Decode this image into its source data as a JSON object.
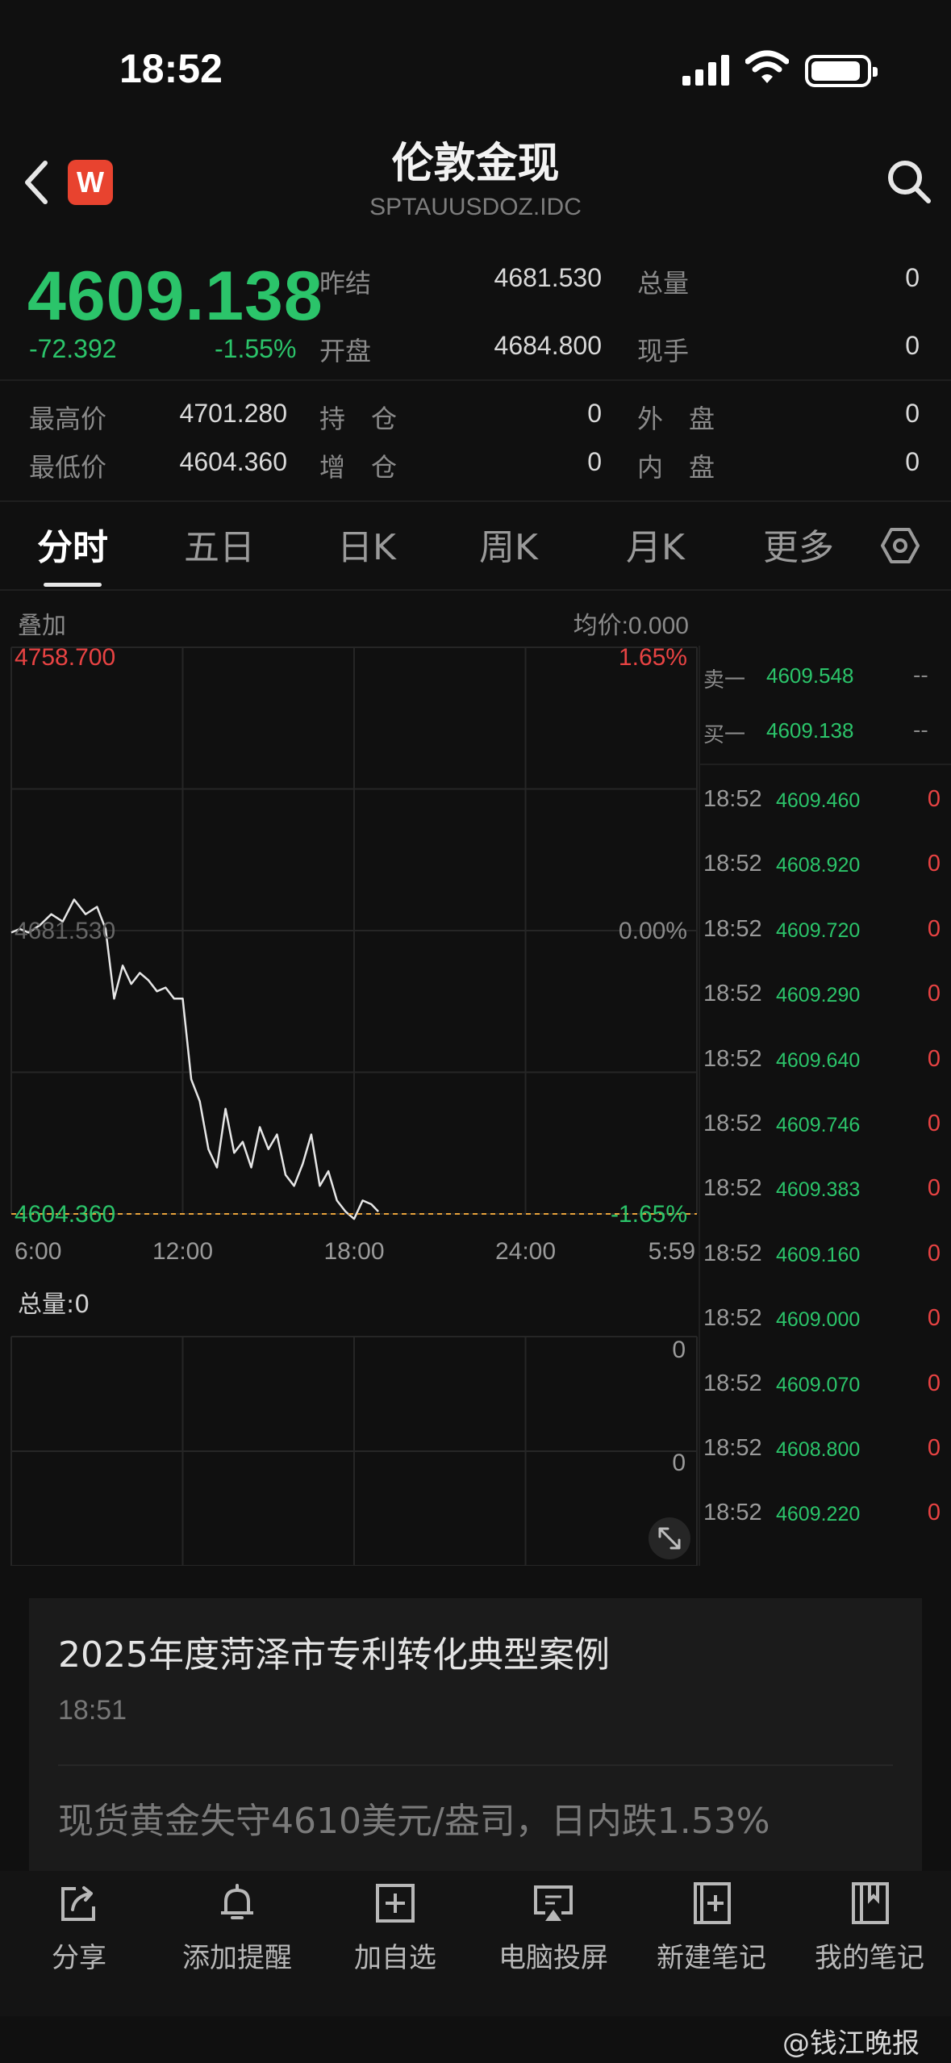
{
  "status": {
    "time": "18:52"
  },
  "header": {
    "title": "伦敦金现",
    "subtitle": "SPTAUUSDOZ.IDC",
    "logo": "W"
  },
  "quote": {
    "price": "4609.138",
    "change": "-72.392",
    "change_pct": "-1.55%",
    "stats": [
      {
        "label": "昨结",
        "value": "4681.530"
      },
      {
        "label": "总量",
        "value": "0"
      },
      {
        "label": "开盘",
        "value": "4684.800"
      },
      {
        "label": "现手",
        "value": "0"
      },
      {
        "label": "最高价",
        "value": "4701.280"
      },
      {
        "label": "持　仓",
        "value": "0"
      },
      {
        "label": "外　盘",
        "value": "0"
      },
      {
        "label": "最低价",
        "value": "4604.360"
      },
      {
        "label": "增　仓",
        "value": "0"
      },
      {
        "label": "内　盘",
        "value": "0"
      }
    ]
  },
  "tabs": [
    "分时",
    "五日",
    "日K",
    "周K",
    "月K",
    "更多"
  ],
  "chart_labels": {
    "overlay": "叠加",
    "avg_price": "均价:0.000",
    "total_volume": "总量:0",
    "volume_ticks": [
      "0",
      "0"
    ]
  },
  "chart_data": {
    "type": "line",
    "xlabel": "",
    "ylabel": "",
    "x_ticks": [
      "6:00",
      "12:00",
      "18:00",
      "24:00",
      "5:59"
    ],
    "y_left_ticks": [
      "4758.700",
      "4681.530",
      "4604.360"
    ],
    "y_right_ticks": [
      "1.65%",
      "0.00%",
      "-1.65%"
    ],
    "ylim": [
      4604.36,
      4758.7
    ],
    "reference_line": 4604.36,
    "series": [
      {
        "x": [
          6.0,
          6.3,
          6.6,
          7.0,
          7.4,
          7.8,
          8.2,
          8.6,
          9.0,
          9.3,
          9.6,
          9.9,
          10.2,
          10.5,
          10.8,
          11.1,
          11.4,
          11.7,
          12.0,
          12.3,
          12.6,
          12.9,
          13.2,
          13.5,
          13.8,
          14.1,
          14.4,
          14.7,
          15.0,
          15.3,
          15.6,
          15.9,
          16.2,
          16.5,
          16.8,
          17.1,
          17.4,
          17.7,
          18.0,
          18.3,
          18.6,
          18.85
        ],
        "values": [
          4681,
          4682,
          4681,
          4683,
          4686,
          4684,
          4690,
          4686,
          4688,
          4682,
          4663,
          4672,
          4667,
          4670,
          4668,
          4665,
          4666,
          4663,
          4663,
          4641,
          4635,
          4622,
          4617,
          4633,
          4621,
          4624,
          4617,
          4628,
          4622,
          4626,
          4615,
          4612,
          4618,
          4626,
          4612,
          4616,
          4608,
          4605,
          4603,
          4608,
          4607,
          4605
        ]
      }
    ]
  },
  "orderbook": {
    "ask": {
      "label": "卖一",
      "price": "4609.548",
      "vol": "--"
    },
    "bid": {
      "label": "买一",
      "price": "4609.138",
      "vol": "--"
    }
  },
  "ticks": [
    {
      "time": "18:52",
      "price": "4609.460",
      "vol": "0"
    },
    {
      "time": "18:52",
      "price": "4608.920",
      "vol": "0"
    },
    {
      "time": "18:52",
      "price": "4609.720",
      "vol": "0"
    },
    {
      "time": "18:52",
      "price": "4609.290",
      "vol": "0"
    },
    {
      "time": "18:52",
      "price": "4609.640",
      "vol": "0"
    },
    {
      "time": "18:52",
      "price": "4609.746",
      "vol": "0"
    },
    {
      "time": "18:52",
      "price": "4609.383",
      "vol": "0"
    },
    {
      "time": "18:52",
      "price": "4609.160",
      "vol": "0"
    },
    {
      "time": "18:52",
      "price": "4609.000",
      "vol": "0"
    },
    {
      "time": "18:52",
      "price": "4609.070",
      "vol": "0"
    },
    {
      "time": "18:52",
      "price": "4608.800",
      "vol": "0"
    },
    {
      "time": "18:52",
      "price": "4609.220",
      "vol": "0"
    }
  ],
  "news": [
    {
      "title": "2025年度菏泽市专利转化典型案例",
      "time": "18:51"
    },
    {
      "title": "现货黄金失守4610美元/盎司，日内跌1.53%"
    }
  ],
  "bottom_bar": [
    {
      "label": "分享",
      "icon": "share-icon"
    },
    {
      "label": "添加提醒",
      "icon": "bell-icon"
    },
    {
      "label": "加自选",
      "icon": "add-watchlist-icon"
    },
    {
      "label": "电脑投屏",
      "icon": "screen-cast-icon"
    },
    {
      "label": "新建笔记",
      "icon": "new-note-icon"
    },
    {
      "label": "我的笔记",
      "icon": "notebook-icon"
    }
  ],
  "watermark": "@钱江晚报",
  "colors": {
    "up": "#e84343",
    "down": "#2bc46a",
    "background": "#101010"
  }
}
